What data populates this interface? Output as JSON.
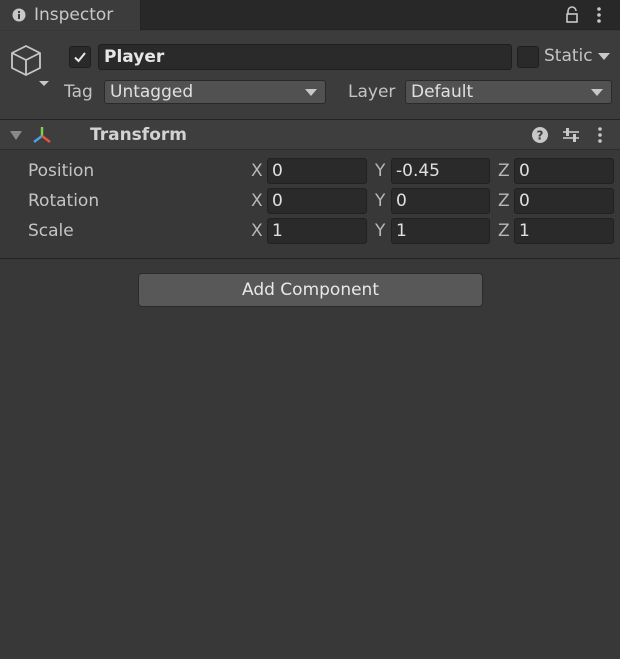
{
  "tab": {
    "title": "Inspector"
  },
  "object": {
    "name": "Player",
    "active": true,
    "static_label": "Static",
    "tag_label": "Tag",
    "tag_value": "Untagged",
    "layer_label": "Layer",
    "layer_value": "Default"
  },
  "component": {
    "title": "Transform",
    "rows": [
      {
        "label": "Position",
        "x": "0",
        "y": "-0.45",
        "z": "0"
      },
      {
        "label": "Rotation",
        "x": "0",
        "y": "0",
        "z": "0"
      },
      {
        "label": "Scale",
        "x": "1",
        "y": "1",
        "z": "1"
      }
    ],
    "axes": {
      "x": "X",
      "y": "Y",
      "z": "Z"
    }
  },
  "add_component_label": "Add Component",
  "colors": {
    "background": "#383838",
    "field": "#2a2a2a",
    "button": "#585858",
    "text": "#c4c4c4"
  },
  "icons": [
    "info-icon",
    "lock-icon",
    "menu-dots-icon",
    "cube-icon",
    "checkmark-icon",
    "caret-down-icon",
    "transform-icon",
    "help-icon",
    "preset-icon"
  ]
}
